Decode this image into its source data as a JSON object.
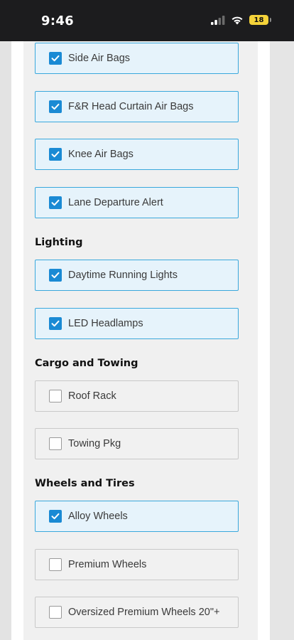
{
  "status_bar": {
    "time": "9:46",
    "battery": "18",
    "icons": [
      "signal-icon",
      "wifi-icon",
      "battery-icon"
    ]
  },
  "colors": {
    "checked_border": "#3aa8dc",
    "checked_background": "#e6f3fb",
    "checkbox_fill": "#1a8ad4"
  },
  "sections": [
    {
      "heading": "",
      "options": [
        {
          "label": "Side Air Bags",
          "checked": true
        },
        {
          "label": "F&R Head Curtain Air Bags",
          "checked": true
        },
        {
          "label": "Knee Air Bags",
          "checked": true
        },
        {
          "label": "Lane Departure Alert",
          "checked": true
        }
      ]
    },
    {
      "heading": "Lighting",
      "options": [
        {
          "label": "Daytime Running Lights",
          "checked": true
        },
        {
          "label": "LED Headlamps",
          "checked": true
        }
      ]
    },
    {
      "heading": "Cargo and Towing",
      "options": [
        {
          "label": "Roof Rack",
          "checked": false
        },
        {
          "label": "Towing Pkg",
          "checked": false
        }
      ]
    },
    {
      "heading": "Wheels and Tires",
      "options": [
        {
          "label": "Alloy Wheels",
          "checked": true
        },
        {
          "label": "Premium Wheels",
          "checked": false
        },
        {
          "label": "Oversized Premium Wheels 20\"+",
          "checked": false
        }
      ]
    }
  ]
}
